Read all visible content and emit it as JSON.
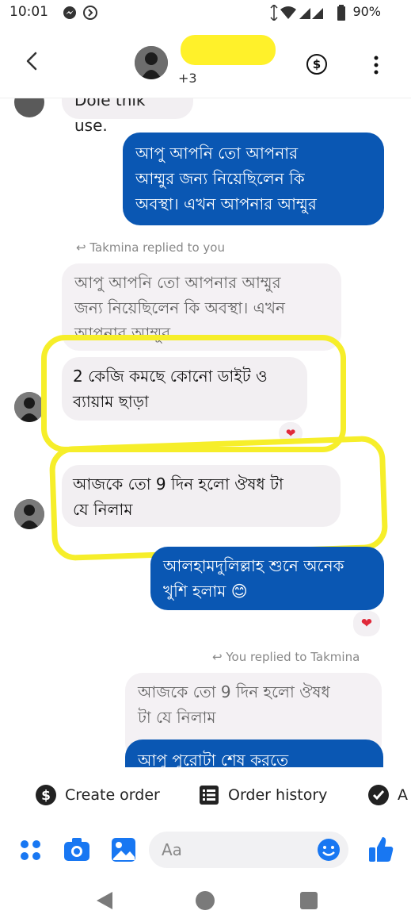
{
  "status": {
    "time": "10:01",
    "battery": "90%"
  },
  "header": {
    "participants_extra": "+3"
  },
  "messages": {
    "cutoff_top": "Dole thik use.",
    "out_1": [
      "আপু আপনি তো আপনার",
      "আম্মুর জন্য নিয়েছিলেন কি",
      "অবস্থা। এখন আপনার আম্মুর"
    ],
    "replied_label_1": "Takmina replied to you",
    "quote_1": [
      "আপু আপনি তো আপনার আম্মুর",
      "জন্য নিয়েছিলেন কি অবস্থা। এখন",
      "আপনার আম্মুর"
    ],
    "in_1": [
      "2 কেজি কমছে কোনো ডাইট ও",
      "ব্যায়াম ছাড়া"
    ],
    "in_2": [
      "আজকে তো 9 দিন হলো ঔষধ টা",
      "যে নিলাম"
    ],
    "out_2": [
      "আলহামদুলিল্লাহ শুনে অনেক",
      "খুশি হলাম 😊"
    ],
    "replied_label_2": "You replied to Takmina",
    "quote_2": [
      "আজকে তো 9 দিন হলো ঔষধ",
      "টা যে নিলাম"
    ],
    "out_3_partial": "আপু পুরোটা শেষ করতে",
    "reaction": "❤"
  },
  "actions": {
    "create_order": "Create order",
    "order_history": "Order history",
    "third": "A"
  },
  "composer": {
    "placeholder": "Aa"
  },
  "colors": {
    "brand_blue": "#0a57b3",
    "highlight": "#f6ee2a",
    "bubble_in": "#f2eff2"
  }
}
